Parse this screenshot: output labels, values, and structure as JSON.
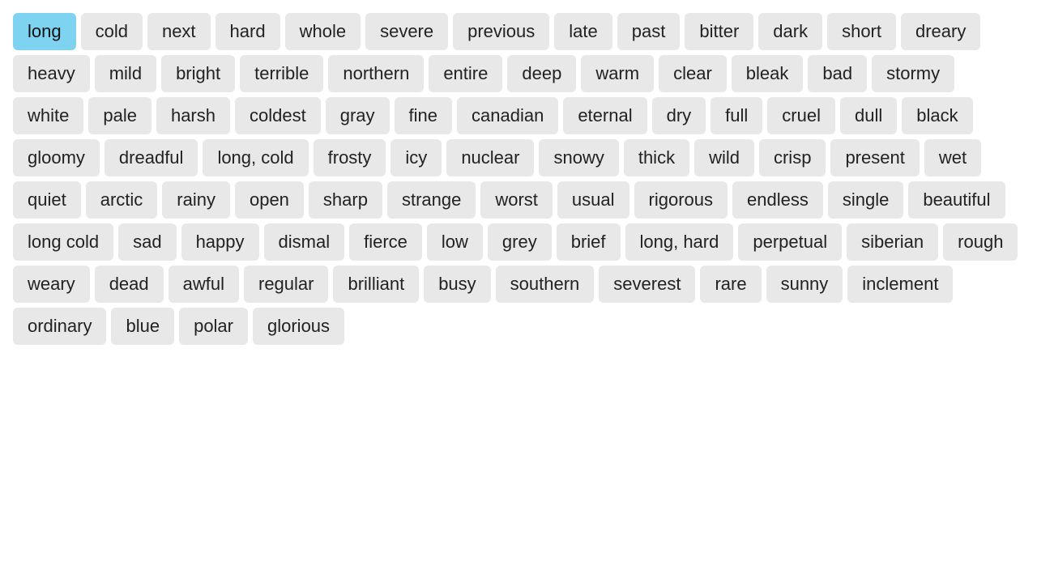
{
  "tags": [
    {
      "label": "long",
      "active": true
    },
    {
      "label": "cold",
      "active": false
    },
    {
      "label": "next",
      "active": false
    },
    {
      "label": "hard",
      "active": false
    },
    {
      "label": "whole",
      "active": false
    },
    {
      "label": "severe",
      "active": false
    },
    {
      "label": "previous",
      "active": false
    },
    {
      "label": "late",
      "active": false
    },
    {
      "label": "past",
      "active": false
    },
    {
      "label": "bitter",
      "active": false
    },
    {
      "label": "dark",
      "active": false
    },
    {
      "label": "short",
      "active": false
    },
    {
      "label": "dreary",
      "active": false
    },
    {
      "label": "heavy",
      "active": false
    },
    {
      "label": "mild",
      "active": false
    },
    {
      "label": "bright",
      "active": false
    },
    {
      "label": "terrible",
      "active": false
    },
    {
      "label": "northern",
      "active": false
    },
    {
      "label": "entire",
      "active": false
    },
    {
      "label": "deep",
      "active": false
    },
    {
      "label": "warm",
      "active": false
    },
    {
      "label": "clear",
      "active": false
    },
    {
      "label": "bleak",
      "active": false
    },
    {
      "label": "bad",
      "active": false
    },
    {
      "label": "stormy",
      "active": false
    },
    {
      "label": "white",
      "active": false
    },
    {
      "label": "pale",
      "active": false
    },
    {
      "label": "harsh",
      "active": false
    },
    {
      "label": "coldest",
      "active": false
    },
    {
      "label": "gray",
      "active": false
    },
    {
      "label": "fine",
      "active": false
    },
    {
      "label": "canadian",
      "active": false
    },
    {
      "label": "eternal",
      "active": false
    },
    {
      "label": "dry",
      "active": false
    },
    {
      "label": "full",
      "active": false
    },
    {
      "label": "cruel",
      "active": false
    },
    {
      "label": "dull",
      "active": false
    },
    {
      "label": "black",
      "active": false
    },
    {
      "label": "gloomy",
      "active": false
    },
    {
      "label": "dreadful",
      "active": false
    },
    {
      "label": "long, cold",
      "active": false
    },
    {
      "label": "frosty",
      "active": false
    },
    {
      "label": "icy",
      "active": false
    },
    {
      "label": "nuclear",
      "active": false
    },
    {
      "label": "snowy",
      "active": false
    },
    {
      "label": "thick",
      "active": false
    },
    {
      "label": "wild",
      "active": false
    },
    {
      "label": "crisp",
      "active": false
    },
    {
      "label": "present",
      "active": false
    },
    {
      "label": "wet",
      "active": false
    },
    {
      "label": "quiet",
      "active": false
    },
    {
      "label": "arctic",
      "active": false
    },
    {
      "label": "rainy",
      "active": false
    },
    {
      "label": "open",
      "active": false
    },
    {
      "label": "sharp",
      "active": false
    },
    {
      "label": "strange",
      "active": false
    },
    {
      "label": "worst",
      "active": false
    },
    {
      "label": "usual",
      "active": false
    },
    {
      "label": "rigorous",
      "active": false
    },
    {
      "label": "endless",
      "active": false
    },
    {
      "label": "single",
      "active": false
    },
    {
      "label": "beautiful",
      "active": false
    },
    {
      "label": "long cold",
      "active": false
    },
    {
      "label": "sad",
      "active": false
    },
    {
      "label": "happy",
      "active": false
    },
    {
      "label": "dismal",
      "active": false
    },
    {
      "label": "fierce",
      "active": false
    },
    {
      "label": "low",
      "active": false
    },
    {
      "label": "grey",
      "active": false
    },
    {
      "label": "brief",
      "active": false
    },
    {
      "label": "long, hard",
      "active": false
    },
    {
      "label": "perpetual",
      "active": false
    },
    {
      "label": "siberian",
      "active": false
    },
    {
      "label": "rough",
      "active": false
    },
    {
      "label": "weary",
      "active": false
    },
    {
      "label": "dead",
      "active": false
    },
    {
      "label": "awful",
      "active": false
    },
    {
      "label": "regular",
      "active": false
    },
    {
      "label": "brilliant",
      "active": false
    },
    {
      "label": "busy",
      "active": false
    },
    {
      "label": "southern",
      "active": false
    },
    {
      "label": "severest",
      "active": false
    },
    {
      "label": "rare",
      "active": false
    },
    {
      "label": "sunny",
      "active": false
    },
    {
      "label": "inclement",
      "active": false
    },
    {
      "label": "ordinary",
      "active": false
    },
    {
      "label": "blue",
      "active": false
    },
    {
      "label": "polar",
      "active": false
    },
    {
      "label": "glorious",
      "active": false
    }
  ]
}
